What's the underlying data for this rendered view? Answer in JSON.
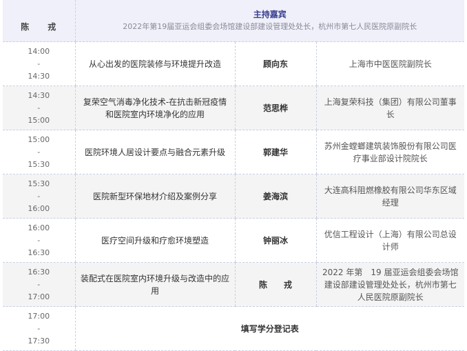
{
  "header": {
    "chair_name": "陈　　戎",
    "chair_label": "主持嘉宾",
    "chair_title": "2022年第19届亚运会组委会场馆建设部建设管理处处长，杭州市第七人民医院原副院长"
  },
  "sessions": [
    {
      "time_start": "14:00",
      "time_sep": "-",
      "time_end": "14:30",
      "topic": "从心出发的医院装修与环境提升改造",
      "speaker": "顾向东",
      "affiliation": "上海市中医医院副院长"
    },
    {
      "time_start": "14:30",
      "time_sep": "-",
      "time_end": "15:00",
      "topic": "复荣空气消毒净化技术-在抗击新冠疫情和医院室内环境净化的应用",
      "speaker": "范思桦",
      "affiliation": "上海复荣科技（集团）有限公司董事长"
    },
    {
      "time_start": "15:00",
      "time_sep": "-",
      "time_end": "15:30",
      "topic": "医院环境人居设计要点与融合元素升级",
      "speaker": "郭建华",
      "affiliation": "苏州金螳螂建筑装饰股份有限公司医疗事业部设计院院长"
    },
    {
      "time_start": "15:30",
      "time_sep": "-",
      "time_end": "16:00",
      "topic": "医院新型环保地材介绍及案例分享",
      "speaker": "姜海滨",
      "affiliation": "大连高科阻燃橡胶有限公司华东区域经理"
    },
    {
      "time_start": "16:00",
      "time_sep": "-",
      "time_end": "16:30",
      "topic": "医疗空间升级和疗愈环境塑造",
      "speaker": "钟丽冰",
      "affiliation": "优信工程设计（上海）有限公司总设计师"
    },
    {
      "time_start": "16:30",
      "time_sep": "-",
      "time_end": "17:00",
      "topic": "装配式在医院室内环境升级与改造中的应用",
      "speaker": "陈　　戎",
      "affiliation": "2022 年第　19 届亚运会组委会场馆建设部建设管理处处长，杭州市第七人民医院原副院长"
    }
  ],
  "closing": {
    "time_start": "17:00",
    "time_sep": "-",
    "time_end": "17:30",
    "label": "填写学分登记表"
  }
}
